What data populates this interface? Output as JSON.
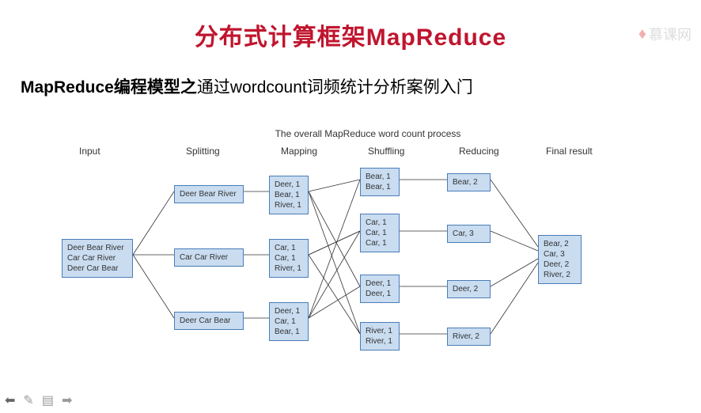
{
  "watermark": {
    "text": "慕课网"
  },
  "title": "分布式计算框架MapReduce",
  "subtitle": {
    "bold": "MapReduce编程模型之",
    "light": "通过wordcount词频统计分析案例入门"
  },
  "diagram": {
    "title": "The overall MapReduce word count process",
    "headers": [
      "Input",
      "Splitting",
      "Mapping",
      "Shuffling",
      "Reducing",
      "Final result"
    ],
    "input": "Deer Bear River\nCar Car River\nDeer Car Bear",
    "splitting": [
      "Deer Bear River",
      "Car Car River",
      "Deer Car Bear"
    ],
    "mapping": [
      "Deer, 1\nBear, 1\nRiver, 1",
      "Car, 1\nCar, 1\nRiver, 1",
      "Deer, 1\nCar, 1\nBear, 1"
    ],
    "shuffling": [
      "Bear, 1\nBear, 1",
      "Car, 1\nCar, 1\nCar, 1",
      "Deer, 1\nDeer, 1",
      "River, 1\nRiver, 1"
    ],
    "reducing": [
      "Bear, 2",
      "Car, 3",
      "Deer, 2",
      "River, 2"
    ],
    "final": "Bear, 2\nCar, 3\nDeer, 2\nRiver, 2"
  }
}
